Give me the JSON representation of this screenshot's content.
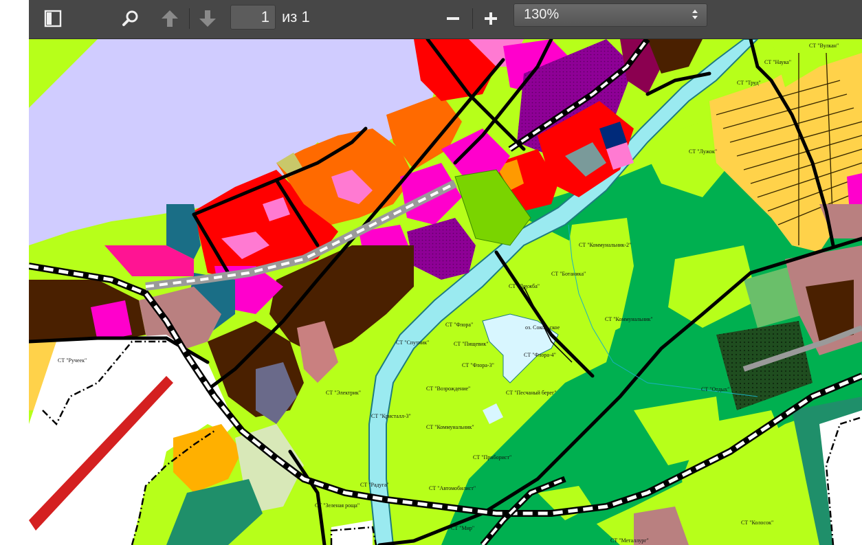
{
  "toolbar": {
    "current_page": "1",
    "page_of": "из 1",
    "zoom_value": "130%",
    "zoom_out_icon": "minus-icon",
    "zoom_in_icon": "plus-icon",
    "sidebar_toggle_icon": "sidebar-icon",
    "search_icon": "search-icon",
    "prev_icon": "arrow-up-icon",
    "next_icon": "arrow-down-icon"
  },
  "map": {
    "labels": {
      "st_vulkan": "СТ \"Вулкан\"",
      "st_nauka": "СТ \"Наука\"",
      "st_trud": "СТ \"Труд\"",
      "st_luzhok": "СТ \"Лужок\"",
      "st_kommunalnik2": "СТ \"Коммунальник-2\"",
      "st_botanika": "СТ \"Ботаника\"",
      "st_druzhba": "СТ \"Дружба\"",
      "st_flora": "СТ \"Флора\"",
      "st_kommunalnik": "СТ \"Коммунальник\"",
      "oz_sokolskoe": "оз. Сокольское",
      "st_sputnik": "СТ \"Спутник\"",
      "st_pishchevik": "СТ \"Пищевик\"",
      "st_flora4": "СТ \"Флора-4\"",
      "st_flora3": "СТ \"Флора-3\"",
      "st_elektrik": "СТ \"Электрик\"",
      "st_vozrozhdenie": "СТ \"Возрождение\"",
      "st_peschany": "СТ \"Песчаный берег\"",
      "st_kristall3": "СТ \"Кристалл-3\"",
      "st_kommunalnik_b": "СТ \"Коммунальник\"",
      "st_otdykh": "СТ \"Отдых\"",
      "st_priborist": "СТ \"Приборист\"",
      "st_raduga": "СТ \"Радуга\"",
      "st_avtomobilist": "СТ \"Автомобилист\"",
      "st_zelenaya_roscha": "СТ \"Зеленая роща\"",
      "st_mir": "СТ \"Мир\"",
      "st_kolos": "СТ \"Колосок\"",
      "st_metallurg": "СТ \"Металлург\"",
      "st_ruchey": "СТ \"Ручеек\""
    }
  },
  "colors": {
    "toolbar_bg": "#474747",
    "lake": "#d0ccff",
    "lime": "#b7ff1a",
    "green": "#00b050",
    "red": "#ff0000",
    "orange": "#ff6a00",
    "magenta": "#ff00cc",
    "purple": "#8b008b",
    "brown": "#4a2000",
    "teal": "#1a6e86",
    "river": "#9aeaf0",
    "yellow": "#ffd24a"
  }
}
